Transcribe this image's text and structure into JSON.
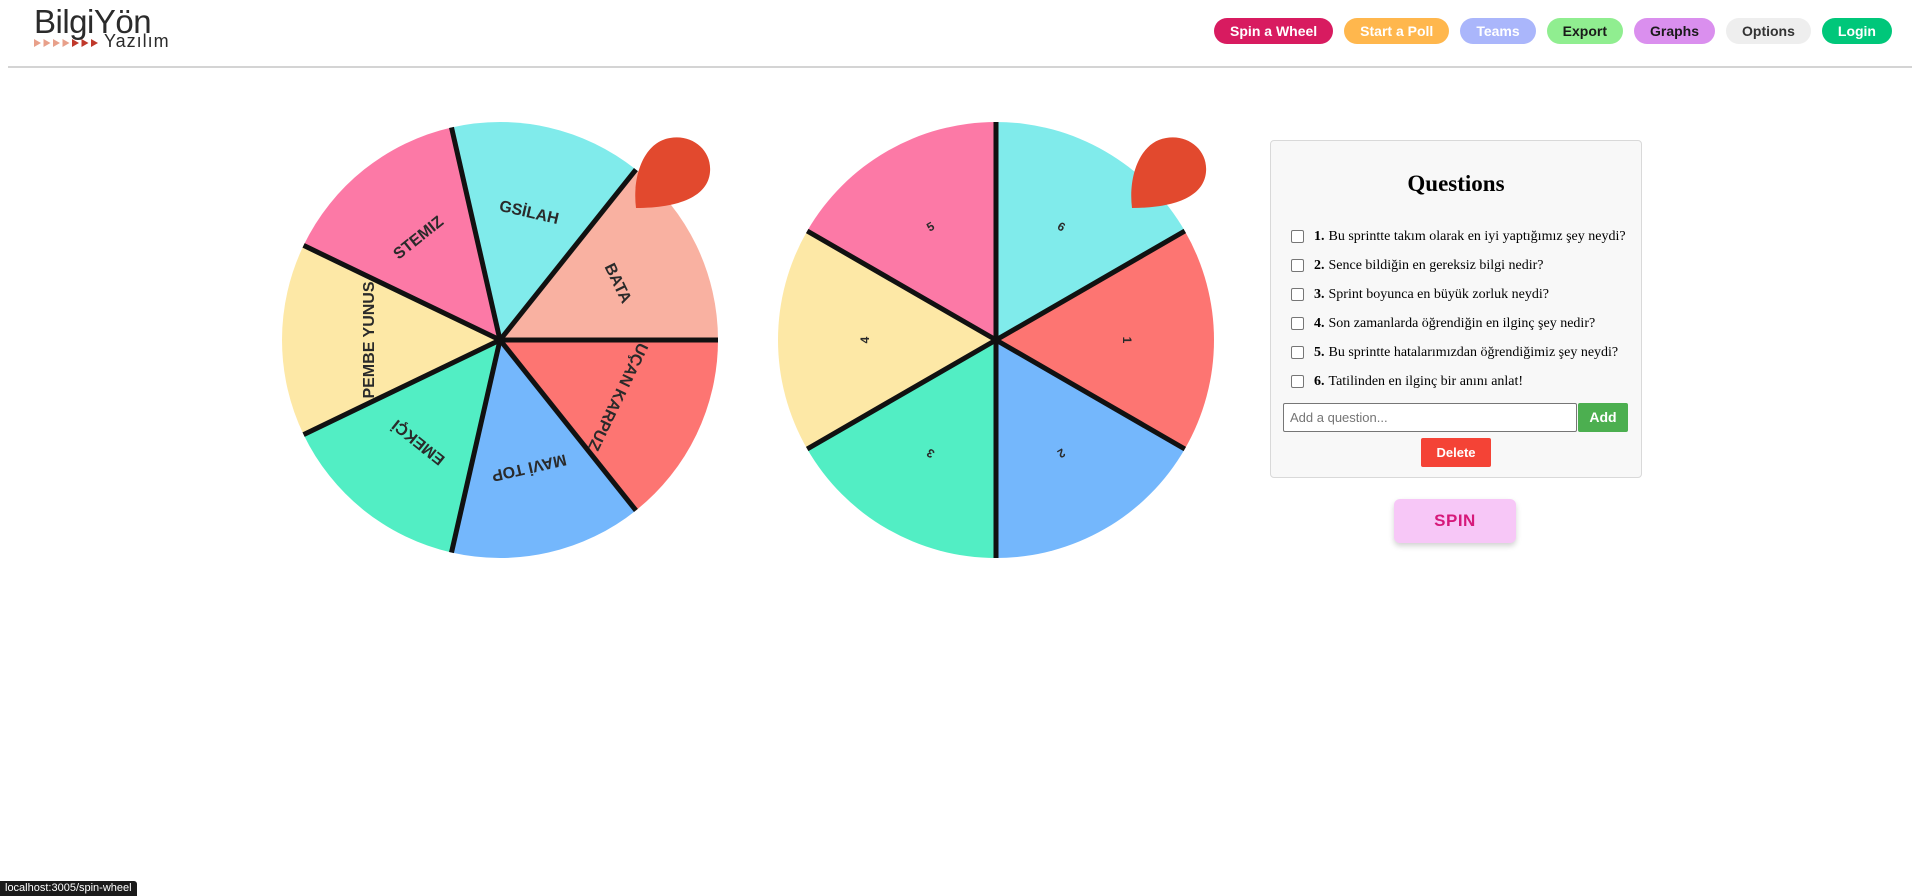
{
  "logo": {
    "main": "BilgiYön",
    "sub": "Yazılım"
  },
  "nav": [
    {
      "label": "Spin a Wheel",
      "bg": "#d81b60",
      "fg": "#ffffff",
      "name": "nav-spin-a-wheel"
    },
    {
      "label": "Start a Poll",
      "bg": "#ffb74d",
      "fg": "#ffffff",
      "name": "nav-start-a-poll"
    },
    {
      "label": "Teams",
      "bg": "#aab6fb",
      "fg": "#ffffff",
      "name": "nav-teams"
    },
    {
      "label": "Export",
      "bg": "#90ee90",
      "fg": "#1a1a1a",
      "name": "nav-export"
    },
    {
      "label": "Graphs",
      "bg": "#da8fee",
      "fg": "#1a1a1a",
      "name": "nav-graphs"
    },
    {
      "label": "Options",
      "bg": "#eeeeee",
      "fg": "#333333",
      "name": "nav-options"
    },
    {
      "label": "Login",
      "bg": "#00c77a",
      "fg": "#ffffff",
      "name": "nav-login"
    }
  ],
  "wheel_teams": {
    "segments": [
      {
        "label": "BATA",
        "color": "#f9b1a1"
      },
      {
        "label": "GSİLAH",
        "color": "#80ebeb"
      },
      {
        "label": "STEMIZ",
        "color": "#fc79a6"
      },
      {
        "label": "PEMBE YUNUS",
        "color": "#fde8a6"
      },
      {
        "label": "EMEKÇİ",
        "color": "#52eec4"
      },
      {
        "label": "MAVİ TOP",
        "color": "#74b7fc"
      },
      {
        "label": "UÇAN KARPUZ",
        "color": "#fd7572"
      }
    ],
    "pointer_color": "#e2492e"
  },
  "wheel_numbers": {
    "segments": [
      {
        "label": "6",
        "color": "#80ebeb"
      },
      {
        "label": "5",
        "color": "#fc79a6"
      },
      {
        "label": "4",
        "color": "#fde8a6"
      },
      {
        "label": "3",
        "color": "#52eec4"
      },
      {
        "label": "2",
        "color": "#74b7fc"
      },
      {
        "label": "1",
        "color": "#fd7572"
      }
    ],
    "pointer_color": "#e2492e"
  },
  "questions": {
    "title": "Questions",
    "items": [
      {
        "num": "1.",
        "text": "Bu sprintte takım olarak en iyi yaptığımız şey neydi?"
      },
      {
        "num": "2.",
        "text": "Sence bildiğin en gereksiz bilgi nedir?"
      },
      {
        "num": "3.",
        "text": "Sprint boyunca en büyük zorluk neydi?"
      },
      {
        "num": "4.",
        "text": "Son zamanlarda öğrendiğin en ilginç şey nedir?"
      },
      {
        "num": "5.",
        "text": "Bu sprintte hatalarımızdan öğrendiğimiz şey neydi?"
      },
      {
        "num": "6.",
        "text": "Tatilinden en ilginç bir anını anlat!"
      }
    ],
    "input_placeholder": "Add a question...",
    "add_label": "Add",
    "delete_label": "Delete"
  },
  "spin_label": "SPIN",
  "status_url": "localhost:3005/spin-wheel"
}
